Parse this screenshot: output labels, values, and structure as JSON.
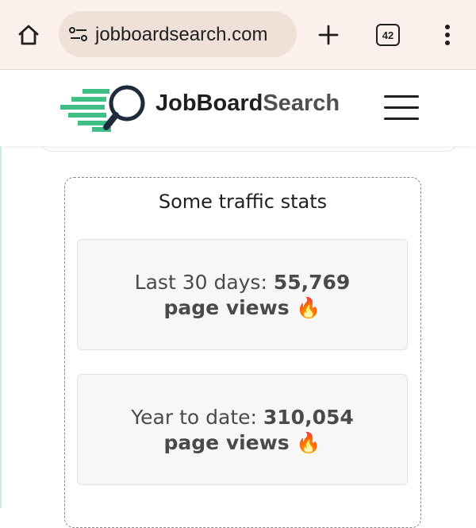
{
  "browser": {
    "url": "jobboardsearch.com",
    "tab_count": "42"
  },
  "site": {
    "brand_part1": "JobBoard",
    "brand_part2": "Search",
    "logo_colors": {
      "speed_lines": "#3dbf86",
      "lens": "#1f2a3a"
    }
  },
  "stats": {
    "title": "Some traffic stats",
    "cards": [
      {
        "label": "Last 30 days: ",
        "value": "55,769",
        "unit": "page views",
        "emoji": "🔥"
      },
      {
        "label": "Year to date: ",
        "value": "310,054",
        "unit": "page views",
        "emoji": "🔥"
      }
    ]
  }
}
